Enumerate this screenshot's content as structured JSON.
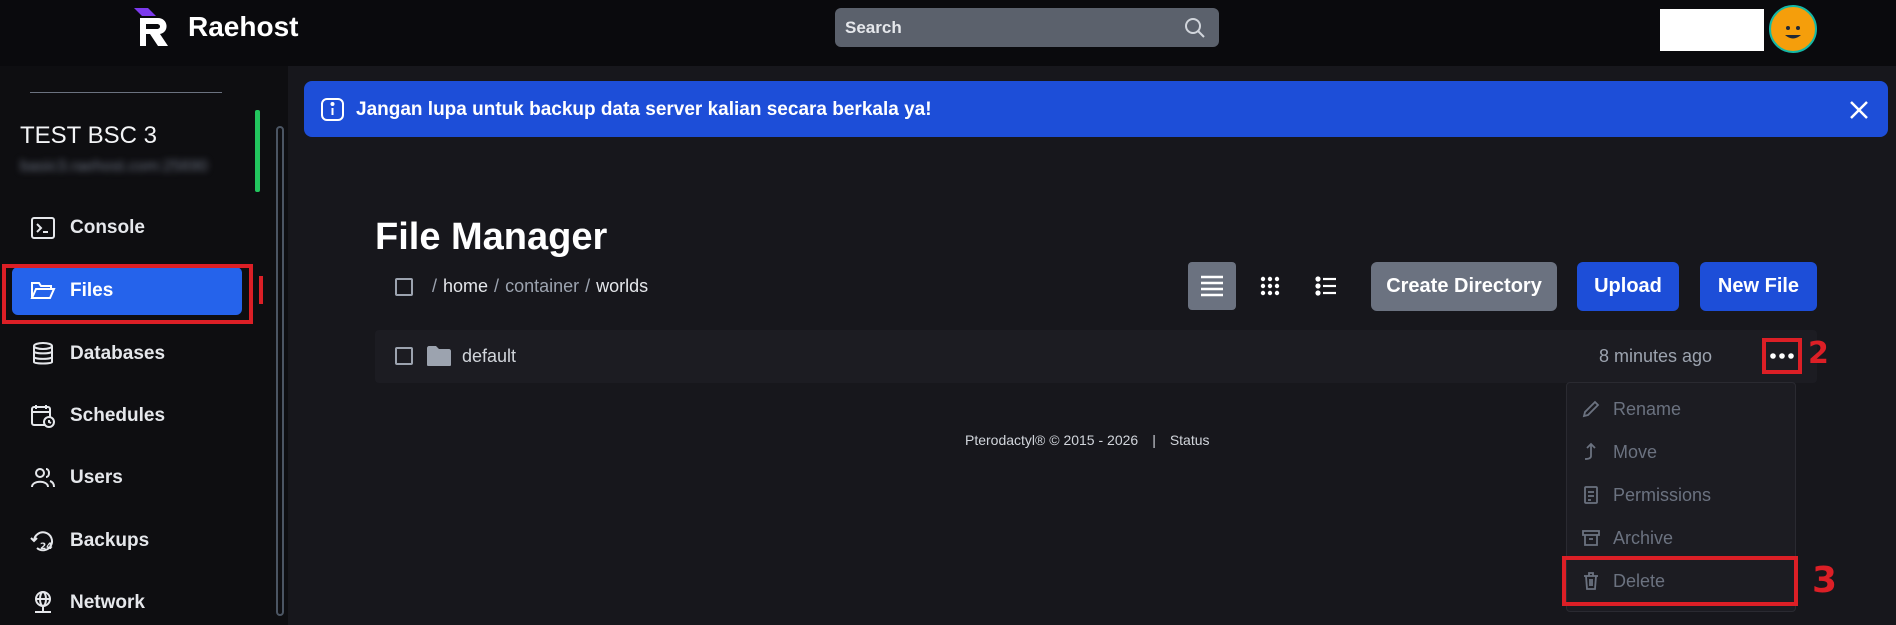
{
  "app": {
    "name": "Raehost"
  },
  "search": {
    "placeholder": "Search"
  },
  "server": {
    "name": "TEST BSC 3",
    "address": "basic3.raehost.com:25690"
  },
  "sidebar": {
    "items": [
      {
        "label": "Console",
        "icon": "terminal-icon"
      },
      {
        "label": "Files",
        "icon": "folder-open-icon",
        "active": true
      },
      {
        "label": "Databases",
        "icon": "database-icon"
      },
      {
        "label": "Schedules",
        "icon": "calendar-clock-icon"
      },
      {
        "label": "Users",
        "icon": "users-icon"
      },
      {
        "label": "Backups",
        "icon": "history-24-icon"
      },
      {
        "label": "Network",
        "icon": "network-icon"
      }
    ]
  },
  "alert": {
    "text": "Jangan lupa untuk backup data server kalian secara berkala ya!"
  },
  "file_manager": {
    "title": "File Manager",
    "breadcrumb": [
      "home",
      "container",
      "worlds"
    ],
    "buttons": {
      "create_directory": "Create Directory",
      "upload": "Upload",
      "new_file": "New File"
    },
    "files": [
      {
        "name": "default",
        "type": "folder",
        "modified": "8 minutes ago"
      }
    ],
    "context_menu": [
      "Rename",
      "Move",
      "Permissions",
      "Archive",
      "Delete"
    ]
  },
  "annotations": {
    "dots": "2",
    "delete": "3"
  },
  "footer": {
    "copyright": "Pterodactyl® © 2015 - 2026",
    "separator": "|",
    "status": "Status"
  },
  "colors": {
    "accent": "#2563eb",
    "highlight": "#dc1f26",
    "status_online": "#22c55e"
  }
}
